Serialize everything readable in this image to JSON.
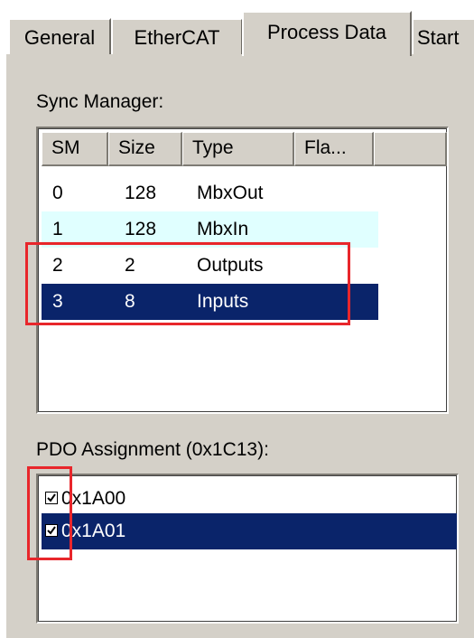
{
  "tabs": [
    {
      "label": "General"
    },
    {
      "label": "EtherCAT"
    },
    {
      "label": "Process Data"
    },
    {
      "label": "Start"
    }
  ],
  "sync_manager": {
    "label": "Sync Manager:",
    "columns": [
      "SM",
      "Size",
      "Type",
      "Fla..."
    ],
    "rows": [
      {
        "sm": "0",
        "size": "128",
        "type": "MbxOut"
      },
      {
        "sm": "1",
        "size": "128",
        "type": "MbxIn"
      },
      {
        "sm": "2",
        "size": "2",
        "type": "Outputs"
      },
      {
        "sm": "3",
        "size": "8",
        "type": "Inputs"
      }
    ]
  },
  "pdo_assignment": {
    "label": "PDO Assignment (0x1C13):",
    "items": [
      {
        "label": "0x1A00",
        "checked": true
      },
      {
        "label": "0x1A01",
        "checked": true
      }
    ]
  },
  "colors": {
    "selection": "#0a246a",
    "highlight_box": "#e8262b",
    "alt_row": "#e0ffff"
  }
}
